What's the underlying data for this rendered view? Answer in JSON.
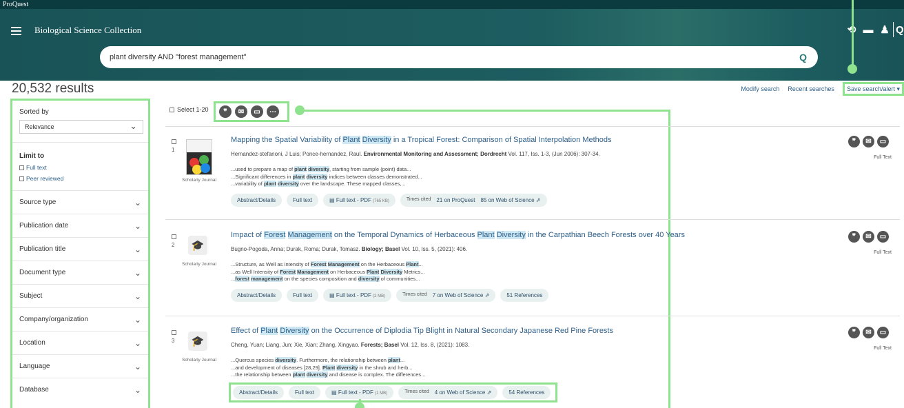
{
  "brand": "ProQuest",
  "collection": "Biological Science Collection",
  "header_icons": [
    "history-icon",
    "folder-icon",
    "user-icon",
    "search-icon"
  ],
  "search": {
    "query": "plant diversity AND \"forest management\""
  },
  "results_count": "20,532 results",
  "top_links": {
    "modify": "Modify search",
    "recent": "Recent searches",
    "save": "Save search/alert ▾"
  },
  "sidebar": {
    "sorted_by": "Sorted by",
    "sort_value": "Relevance",
    "limit_to": "Limit to",
    "limits": [
      "Full text",
      "Peer reviewed"
    ],
    "facets": [
      "Source type",
      "Publication date",
      "Publication title",
      "Document type",
      "Subject",
      "Company/organization",
      "Location",
      "Language",
      "Database"
    ]
  },
  "select_label": "Select 1-20",
  "results": [
    {
      "num": "1",
      "title": [
        [
          "Mapping the Spatial Variability of ",
          false
        ],
        [
          "Plant",
          true
        ],
        [
          " ",
          false
        ],
        [
          "Diversity",
          true
        ],
        [
          " in a Tropical Forest: Comparison of Spatial Interpolation Methods",
          false
        ]
      ],
      "authors": "Hernandez-stefanoni, J Luis; Ponce-hernandez, Raul.",
      "source": "Environmental Monitoring and Assessment; Dordrecht",
      "details": "Vol. 117, Iss. 1-3,  (Jun 2006): 307-34.",
      "snippets": [
        [
          [
            "...used to prepare a map of ",
            false
          ],
          [
            "plant",
            true
          ],
          [
            " ",
            false
          ],
          [
            "diversity",
            true
          ],
          [
            ", starting from sample (point) data...",
            false
          ]
        ],
        [
          [
            "...Significant differences in ",
            false
          ],
          [
            "plant",
            true
          ],
          [
            " ",
            false
          ],
          [
            "diversity",
            true
          ],
          [
            " indices between classes demonstrated...",
            false
          ]
        ],
        [
          [
            "...variability of ",
            false
          ],
          [
            "plant",
            true
          ],
          [
            " ",
            false
          ],
          [
            "diversity",
            true
          ],
          [
            " over the landscape. These mapped classes,...",
            false
          ]
        ]
      ],
      "doc_type": "Scholarly Journal",
      "abstract": "Abstract/Details",
      "fulltext": "Full text",
      "pdf": "Full text - PDF",
      "pdf_size": "(765 KB)",
      "times_cited": "Times cited",
      "cite1": "21 on ProQuest",
      "cite2": "85 on Web of Science ⇗",
      "refs": "",
      "fulltext_label": "Full Text"
    },
    {
      "num": "2",
      "title": [
        [
          "Impact of ",
          false
        ],
        [
          "Forest",
          true
        ],
        [
          " ",
          false
        ],
        [
          "Management",
          true
        ],
        [
          " on the Temporal Dynamics of Herbaceous ",
          false
        ],
        [
          "Plant",
          true
        ],
        [
          " ",
          false
        ],
        [
          "Diversity",
          true
        ],
        [
          " in the Carpathian Beech Forests over 40 Years",
          false
        ]
      ],
      "authors": "Bugno-Pogoda, Anna; Durak, Roma; Durak, Tomasz.",
      "source": "Biology; Basel",
      "details": "Vol. 10, Iss. 5,  (2021): 406.",
      "snippets": [
        [
          [
            "...Structure, as Well as Intensity of ",
            false
          ],
          [
            "Forest",
            true
          ],
          [
            " ",
            false
          ],
          [
            "Management",
            true
          ],
          [
            " on the Herbaceous ",
            false
          ],
          [
            "Plant",
            true
          ],
          [
            "...",
            false
          ]
        ],
        [
          [
            "...as Well Intensity of ",
            false
          ],
          [
            "Forest",
            true
          ],
          [
            " ",
            false
          ],
          [
            "Management",
            true
          ],
          [
            " on Herbaceous ",
            false
          ],
          [
            "Plant",
            true
          ],
          [
            " ",
            false
          ],
          [
            "Diversity",
            true
          ],
          [
            " Metrics...",
            false
          ]
        ],
        [
          [
            "...",
            false
          ],
          [
            "forest",
            true
          ],
          [
            " ",
            false
          ],
          [
            "management",
            true
          ],
          [
            " on the species composition and ",
            false
          ],
          [
            "diversity",
            true
          ],
          [
            " of communities...",
            false
          ]
        ]
      ],
      "doc_type": "Scholarly Journal",
      "abstract": "Abstract/Details",
      "fulltext": "Full text",
      "pdf": "Full text - PDF",
      "pdf_size": "(2 MB)",
      "times_cited": "Times cited",
      "cite1": "7 on Web of Science ⇗",
      "cite2": "",
      "refs": "51 References",
      "fulltext_label": "Full Text"
    },
    {
      "num": "3",
      "title": [
        [
          "Effect of ",
          false
        ],
        [
          "Plant",
          true
        ],
        [
          " ",
          false
        ],
        [
          "Diversity",
          true
        ],
        [
          " on the Occurrence of Diplodia Tip Blight in Natural Secondary Japanese Red Pine Forests",
          false
        ]
      ],
      "authors": "Cheng, Yuan; Liang, Jun; Xie, Xian; Zhang, Xingyao.",
      "source": "Forests; Basel",
      "details": "Vol. 12, Iss. 8,  (2021): 1083.",
      "snippets": [
        [
          [
            "...Quercus species ",
            false
          ],
          [
            "diversity",
            true
          ],
          [
            ". Furthermore, the relationship between ",
            false
          ],
          [
            "plant",
            true
          ],
          [
            "...",
            false
          ]
        ],
        [
          [
            "...and development of diseases [28,29]. ",
            false
          ],
          [
            "Plant",
            true
          ],
          [
            " ",
            false
          ],
          [
            "diversity",
            true
          ],
          [
            " in the shrub and herb...",
            false
          ]
        ],
        [
          [
            "...the relationship between ",
            false
          ],
          [
            "plant",
            true
          ],
          [
            " ",
            false
          ],
          [
            "diversity",
            true
          ],
          [
            " and disease is complex. The differences...",
            false
          ]
        ]
      ],
      "doc_type": "Scholarly Journal",
      "abstract": "Abstract/Details",
      "fulltext": "Full text",
      "pdf": "Full text - PDF",
      "pdf_size": "(1 MB)",
      "times_cited": "Times cited",
      "cite1": "4 on Web of Science ⇗",
      "cite2": "",
      "refs": "54 References",
      "fulltext_label": "Full Text"
    }
  ],
  "colors": {
    "header": "#195357",
    "highlight": "#cde8f3",
    "annotation": "#8fe38f",
    "link": "#2d5f8a"
  }
}
